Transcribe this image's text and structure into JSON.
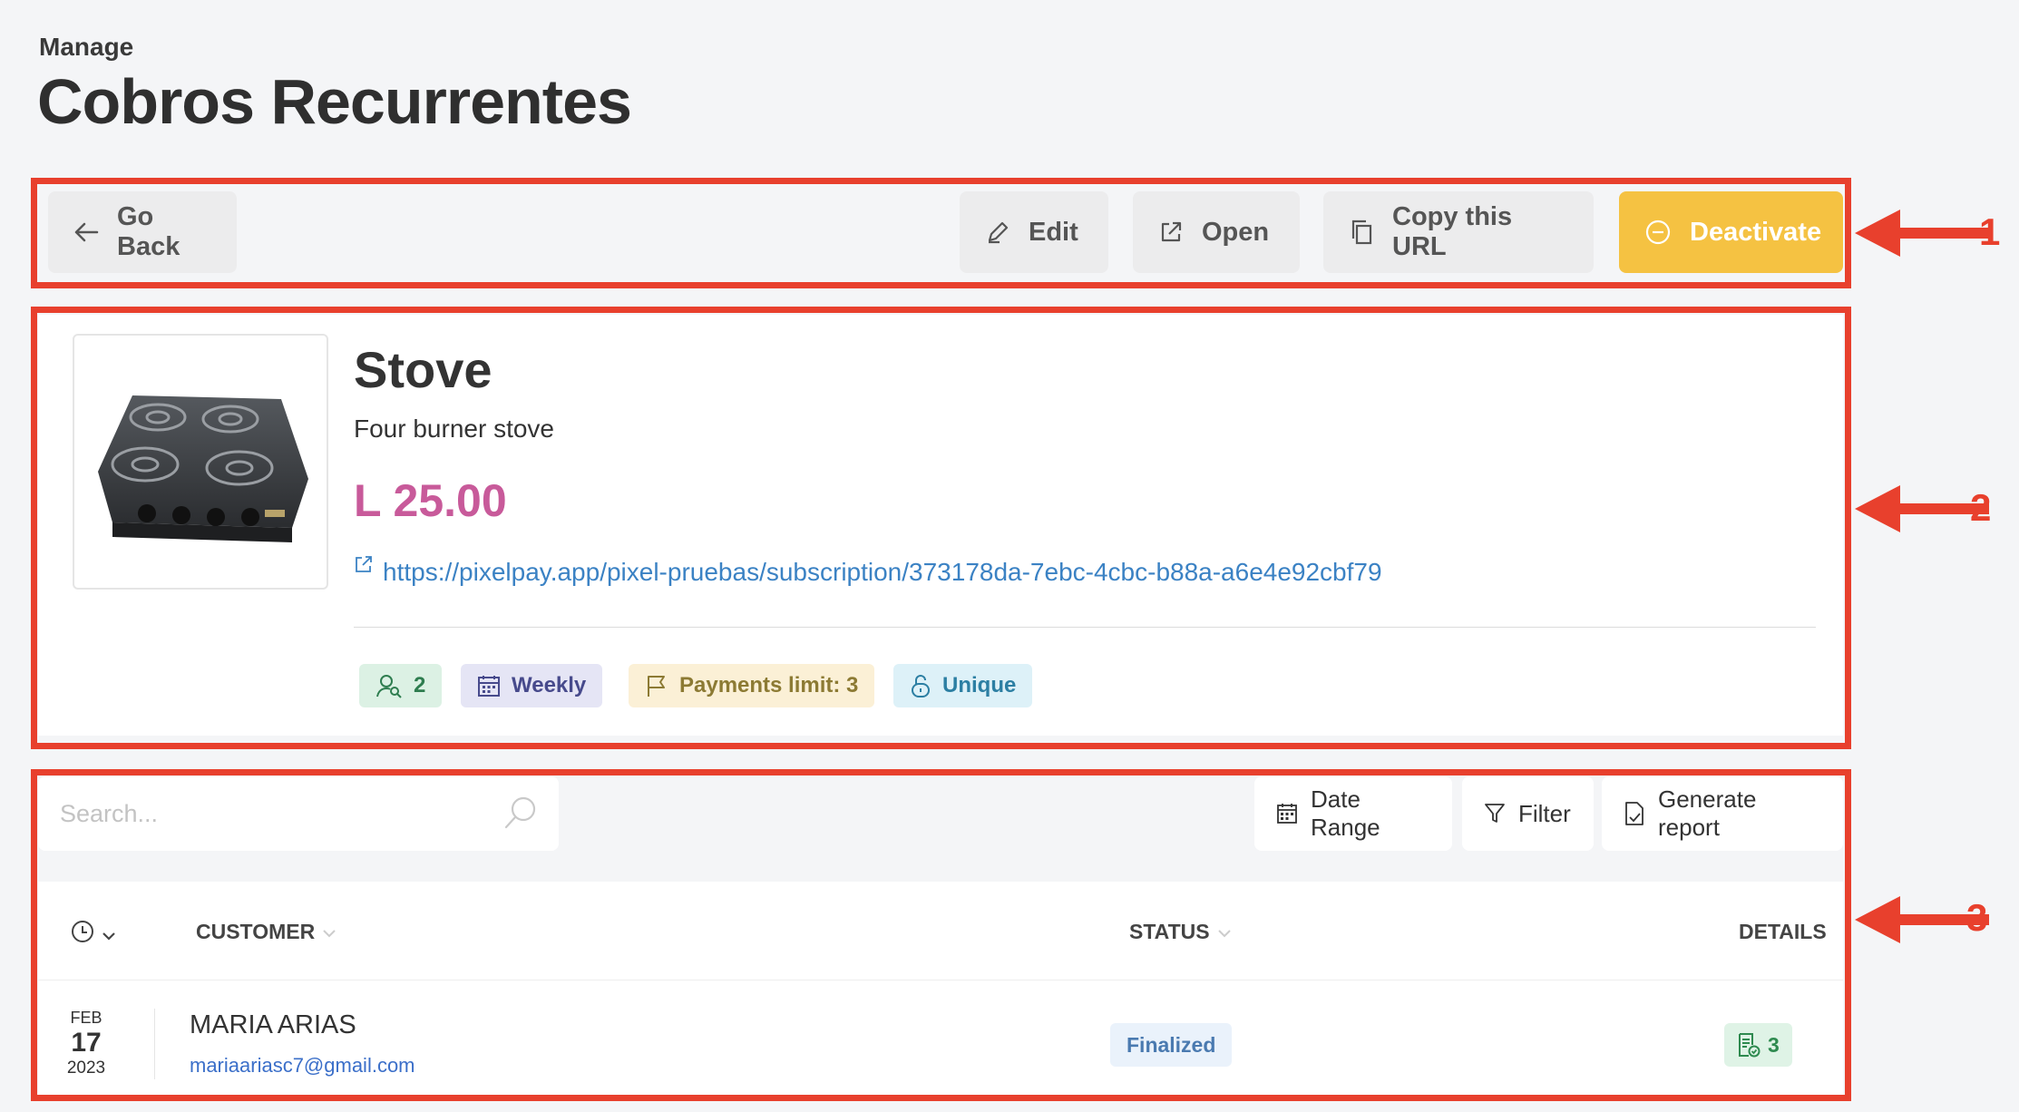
{
  "header": {
    "caption": "Manage",
    "title": "Cobros Recurrentes"
  },
  "toolbar": {
    "go_back": "Go Back",
    "edit": "Edit",
    "open": "Open",
    "copy_url": "Copy this URL",
    "deactivate": "Deactivate"
  },
  "product": {
    "name": "Stove",
    "description": "Four burner stove",
    "price": "L 25.00",
    "url": "https://pixelpay.app/pixel-pruebas/subscription/373178da-7ebc-4cbc-b88a-a6e4e92cbf79",
    "tags": {
      "customers": "2",
      "frequency": "Weekly",
      "payments_limit": "Payments limit: 3",
      "type": "Unique"
    }
  },
  "list": {
    "search_placeholder": "Search...",
    "date_range": "Date Range",
    "filter": "Filter",
    "generate_report": "Generate report",
    "columns": {
      "customer": "CUSTOMER",
      "status": "STATUS",
      "details": "DETAILS"
    },
    "rows": [
      {
        "month": "FEB",
        "day": "17",
        "year": "2023",
        "name": "MARIA ARIAS",
        "email": "mariaariasc7@gmail.com",
        "status": "Finalized",
        "details_count": "3"
      }
    ]
  },
  "annotations": {
    "label_1": "1",
    "label_2": "2",
    "label_3": "3"
  },
  "colors": {
    "highlight": "#e8402d",
    "primary_button": "#f5c242",
    "price": "#c85a9a",
    "link": "#3b82c4"
  }
}
